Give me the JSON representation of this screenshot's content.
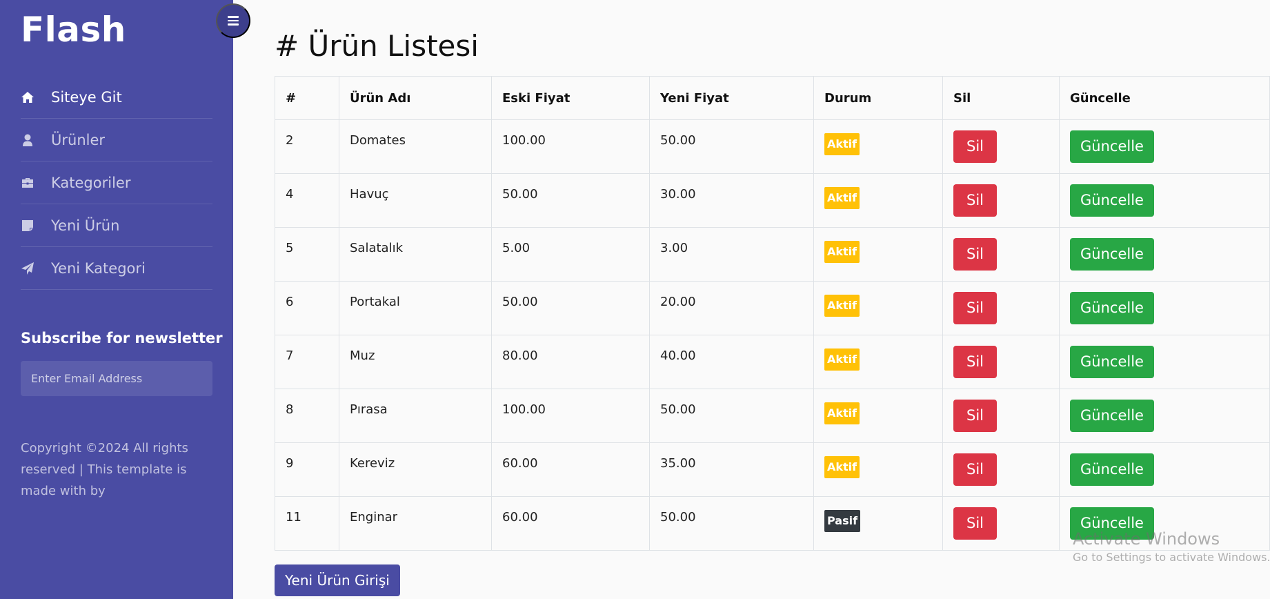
{
  "sidebar": {
    "brand": "Flash",
    "nav": [
      {
        "label": "Siteye Git",
        "icon": "home-icon",
        "active": true
      },
      {
        "label": "Ürünler",
        "icon": "user-icon"
      },
      {
        "label": "Kategoriler",
        "icon": "briefcase-icon"
      },
      {
        "label": "Yeni Ürün",
        "icon": "sticky-note-icon"
      },
      {
        "label": "Yeni Kategori",
        "icon": "paper-plane-icon"
      }
    ],
    "newsletter": {
      "title": "Subscribe for newsletter",
      "placeholder": "Enter Email Address"
    },
    "copyright": "Copyright ©2024 All rights reserved | This template is made with by"
  },
  "main": {
    "title": "# Ürün Listesi",
    "table": {
      "headers": [
        "#",
        "Ürün Adı",
        "Eski Fiyat",
        "Yeni Fiyat",
        "Durum",
        "Sil",
        "Güncelle"
      ],
      "rows": [
        {
          "id": "2",
          "name": "Domates",
          "old_price": "100.00",
          "new_price": "50.00",
          "status": "Aktif",
          "delete": "Sil",
          "update": "Güncelle"
        },
        {
          "id": "4",
          "name": "Havuç",
          "old_price": "50.00",
          "new_price": "30.00",
          "status": "Aktif",
          "delete": "Sil",
          "update": "Güncelle"
        },
        {
          "id": "5",
          "name": "Salatalık",
          "old_price": "5.00",
          "new_price": "3.00",
          "status": "Aktif",
          "delete": "Sil",
          "update": "Güncelle"
        },
        {
          "id": "6",
          "name": "Portakal",
          "old_price": "50.00",
          "new_price": "20.00",
          "status": "Aktif",
          "delete": "Sil",
          "update": "Güncelle"
        },
        {
          "id": "7",
          "name": "Muz",
          "old_price": "80.00",
          "new_price": "40.00",
          "status": "Aktif",
          "delete": "Sil",
          "update": "Güncelle"
        },
        {
          "id": "8",
          "name": "Pırasa",
          "old_price": "100.00",
          "new_price": "50.00",
          "status": "Aktif",
          "delete": "Sil",
          "update": "Güncelle"
        },
        {
          "id": "9",
          "name": "Kereviz",
          "old_price": "60.00",
          "new_price": "35.00",
          "status": "Aktif",
          "delete": "Sil",
          "update": "Güncelle"
        },
        {
          "id": "11",
          "name": "Enginar",
          "old_price": "60.00",
          "new_price": "50.00",
          "status": "Pasif",
          "delete": "Sil",
          "update": "Güncelle"
        }
      ]
    },
    "new_product_button": "Yeni Ürün Girişi"
  },
  "watermark": {
    "line1": "Activate Windows",
    "line2": "Go to Settings to activate Windows."
  },
  "colors": {
    "sidebar": "#4a4ca3",
    "aktif": "#ffc107",
    "pasif": "#343a40",
    "danger": "#dc3545",
    "success": "#28a745"
  }
}
